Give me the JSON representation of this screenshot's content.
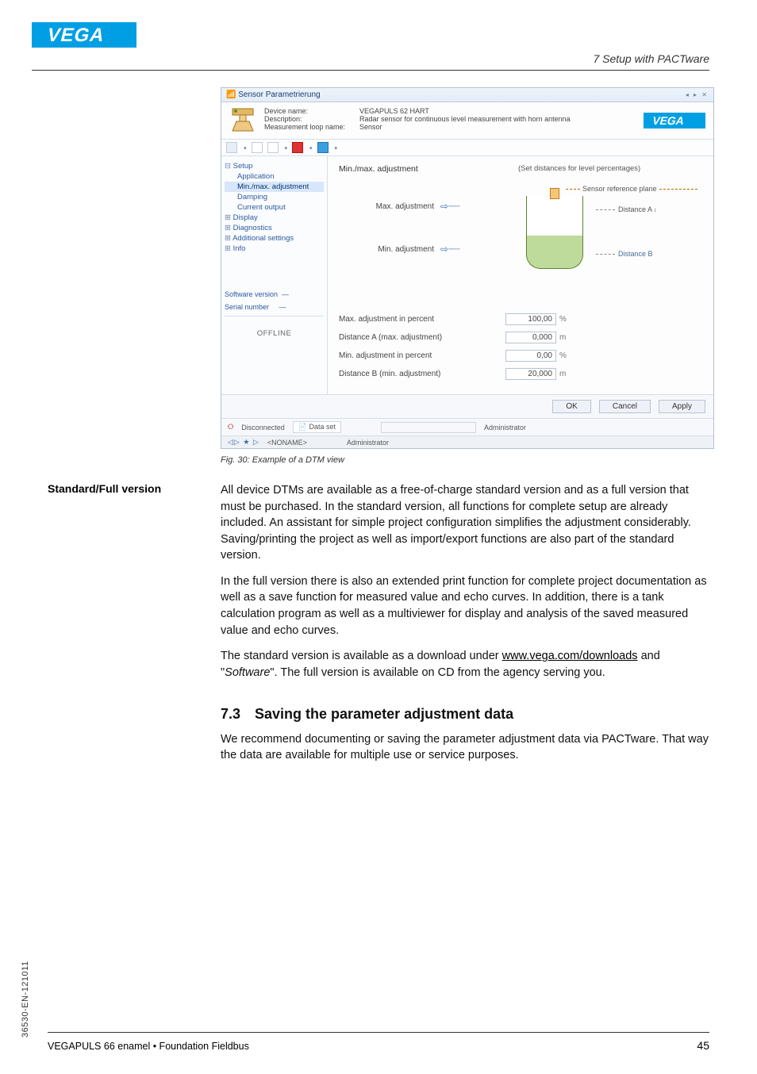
{
  "header": {
    "section_title": "7 Setup with PACTware"
  },
  "dtm": {
    "titlebar": "Sensor Parametrierung",
    "fields": {
      "device_name_label": "Device name:",
      "device_name_value": "VEGAPULS 62 HART",
      "description_label": "Description:",
      "description_value": "Radar sensor for continuous level measurement with horn antenna",
      "loop_label": "Measurement loop name:",
      "loop_value": "Sensor"
    },
    "tree": {
      "setup": "Setup",
      "application": "Application",
      "minmax": "Min./max. adjustment",
      "damping": "Damping",
      "current_output": "Current output",
      "display": "Display",
      "diagnostics": "Diagnostics",
      "additional": "Additional settings",
      "info": "Info",
      "sw_version_label": "Software version",
      "sw_version_value": "—",
      "serial_label": "Serial number",
      "serial_value": "—",
      "offline": "OFFLINE"
    },
    "main": {
      "title": "Min./max. adjustment",
      "hint": "(Set distances for level percentages)",
      "ref_plane": "Sensor reference plane",
      "max_adj": "Max. adjustment",
      "min_adj": "Min. adjustment",
      "dist_a": "Distance A",
      "dist_b": "Distance B",
      "p_max_pct_label": "Max. adjustment in percent",
      "p_max_pct_val": "100,00",
      "p_dist_a_label": "Distance A (max. adjustment)",
      "p_dist_a_val": "0,000",
      "p_min_pct_label": "Min. adjustment in percent",
      "p_min_pct_val": "0,00",
      "p_dist_b_label": "Distance B (min. adjustment)",
      "p_dist_b_val": "20,000",
      "unit_pct": "%",
      "unit_m": "m"
    },
    "buttons": {
      "ok": "OK",
      "cancel": "Cancel",
      "apply": "Apply"
    },
    "status": {
      "disconnected": "Disconnected",
      "dataset": "Data set",
      "admin": "Administrator",
      "noname": "<NONAME>"
    }
  },
  "fig_caption": "Fig. 30: Example of a DTM view",
  "side_label": "Standard/Full version",
  "para1": "All device DTMs are available as a free-of-charge standard version and as a full version that must be purchased. In the standard version, all functions for complete setup are already included. An assistant for simple project configuration simplifies the adjustment considerably. Saving/printing the project as well as import/export functions are also part of the standard version.",
  "para2": "In the full version there is also an extended print function for complete project documentation as well as a save function for measured value and echo curves. In addition, there is a tank calculation program as well as a multiviewer for display and analysis of the saved measured value and echo curves.",
  "para3_a": "The standard version is available as a download under ",
  "para3_link": "www.vega.com/downloads",
  "para3_b": " and \"",
  "para3_soft": "Software",
  "para3_c": "\". The full version is available on CD from the agency serving you.",
  "sec73_num": "7.3",
  "sec73_title": "Saving the parameter adjustment data",
  "para4": "We recommend documenting or saving the parameter adjustment data via PACTware. That way the data are available for multiple use or service purposes.",
  "doc_id": "36530-EN-121011",
  "footer_left": "VEGAPULS 66 enamel • Foundation Fieldbus",
  "footer_right": "45"
}
